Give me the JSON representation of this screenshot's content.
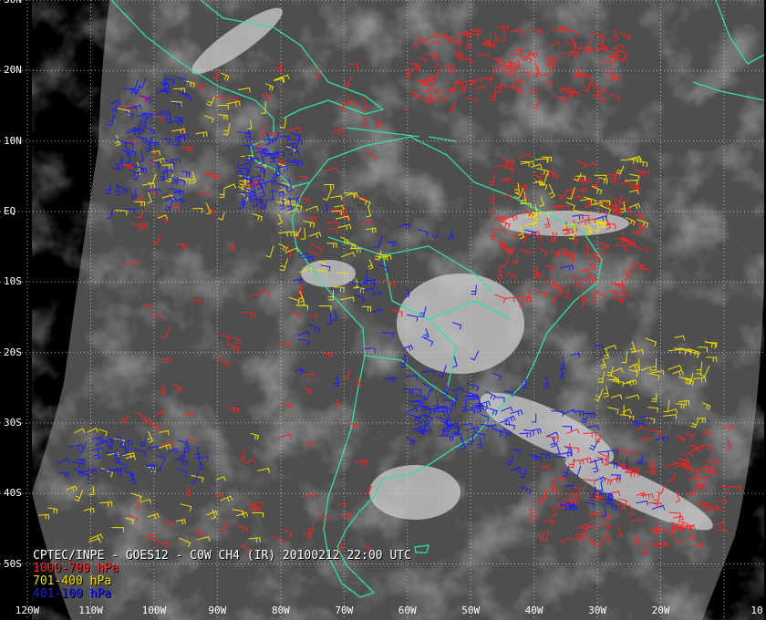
{
  "caption": {
    "title": "CPTEC/INPE - GOES12 - C0W CH4 (IR) 20100212 22:00 UTC",
    "legend": [
      {
        "label": "1000-700 hPa",
        "color": "#ff2020"
      },
      {
        "label": "701-400 hPa",
        "color": "#f0e000"
      },
      {
        "label": "401-100 hPa",
        "color": "#1a1aff"
      }
    ]
  },
  "map": {
    "extent": {
      "lon": [
        -120,
        -10
      ],
      "lat": [
        -53,
        30
      ]
    },
    "lat_labels": [
      "30N",
      "20N",
      "10N",
      "EQ",
      "10S",
      "20S",
      "30S",
      "40S",
      "50S"
    ],
    "lat_values": [
      30,
      20,
      10,
      0,
      -10,
      -20,
      -30,
      -40,
      -50
    ],
    "lon_labels": [
      "120W",
      "110W",
      "100W",
      "90W",
      "80W",
      "70W",
      "60W",
      "50W",
      "40W",
      "30W",
      "20W",
      "10"
    ],
    "lon_values": [
      -120,
      -110,
      -100,
      -90,
      -80,
      -70,
      -60,
      -50,
      -40,
      -30,
      -20,
      -10
    ],
    "colors": {
      "background": "#000000",
      "satellite": "#5a5a5a",
      "coastline": "#33e0a0",
      "grid": "#d0d0d0"
    }
  }
}
